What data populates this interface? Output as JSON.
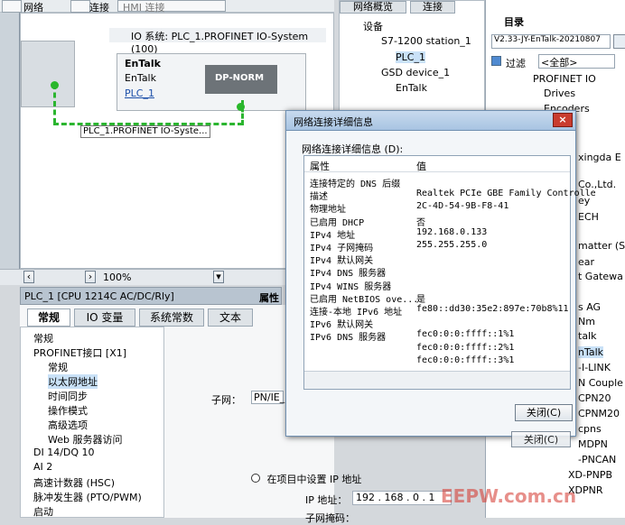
{
  "toolbar": {
    "network": "网络",
    "connection": "连接",
    "hmi_connection": "HMI 连接"
  },
  "canvas": {
    "title": "IO 系统: PLC_1.PROFINET IO-System (100)",
    "device_name": "EnTalk",
    "device_type": "EnTalk",
    "device_link": "PLC_1",
    "device_card": "DP-NORM",
    "network_label": "PLC_1.PROFINET IO-Syste...",
    "zoom": "100%"
  },
  "properties": {
    "header": "PLC_1 [CPU 1214C AC/DC/Rly]",
    "header_right": "属性",
    "tabs": [
      "常规",
      "IO 变量",
      "系统常数",
      "文本"
    ],
    "tree": [
      "常规",
      "PROFINET接口 [X1]",
      "常规",
      "以太网地址",
      "时间同步",
      "操作模式",
      "高级选项",
      "Web 服务器访问",
      "DI 14/DQ 10",
      "AI 2",
      "高速计数器 (HSC)",
      "脉冲发生器 (PTO/PWM)",
      "启动"
    ],
    "subnet_label": "子网：",
    "subnet_value": "PN/IE_",
    "ip_option": "在项目中设置 IP 地址",
    "ip_label": "IP 地址：",
    "ip_value": "192 . 168 . 0 . 1",
    "mask_label": "子网掩码："
  },
  "network_overview": {
    "tabs": [
      "网络概览",
      "连接"
    ],
    "header": "设备",
    "items": [
      "S7-1200 station_1",
      "PLC_1",
      "GSD device_1",
      "EnTalk"
    ]
  },
  "catalog": {
    "title": "目录",
    "search": "V2.33-JY-EnTalk-20210807",
    "filter_label": "过滤",
    "filter_value": "<全部>",
    "items": [
      "PROFINET IO",
      "Drives",
      "Encoders",
      "xingda E",
      "Co.,Ltd.",
      "ey",
      "ECH",
      "matter (S",
      "ear",
      "t Gatewa",
      "s AG",
      "Nm",
      "talk",
      "nTalk",
      "-I-LINK",
      "N Couple",
      "CPN20",
      "CPNM20",
      "cpns",
      "MDPN",
      "-PNCAN",
      "XD-PNPB",
      "XDPNR"
    ]
  },
  "dialog": {
    "title": "网络连接详细信息",
    "subtitle": "网络连接详细信息 (D):",
    "col_property": "属性",
    "col_value": "值",
    "rows": [
      {
        "k": "连接特定的 DNS 后缀",
        "v": ""
      },
      {
        "k": "描述",
        "v": "Realtek PCIe GBE Family Controlle"
      },
      {
        "k": "物理地址",
        "v": "2C-4D-54-9B-F8-41"
      },
      {
        "k": "已启用 DHCP",
        "v": "否"
      },
      {
        "k": "IPv4 地址",
        "v": "192.168.0.133"
      },
      {
        "k": "IPv4 子网掩码",
        "v": "255.255.255.0"
      },
      {
        "k": "IPv4 默认网关",
        "v": ""
      },
      {
        "k": "IPv4 DNS 服务器",
        "v": ""
      },
      {
        "k": "IPv4 WINS 服务器",
        "v": ""
      },
      {
        "k": "已启用 NetBIOS ove...",
        "v": "是"
      },
      {
        "k": "连接-本地 IPv6 地址",
        "v": "fe80::dd30:35e2:897e:70b8%11"
      },
      {
        "k": "IPv6 默认网关",
        "v": ""
      },
      {
        "k": "IPv6 DNS 服务器",
        "v": "fec0:0:0:ffff::1%1"
      },
      {
        "k": "",
        "v": "fec0:0:0:ffff::2%1"
      },
      {
        "k": "",
        "v": "fec0:0:0:ffff::3%1"
      }
    ],
    "close_button": "关闭(C)",
    "back_button": "关闭(C)"
  },
  "watermark": "EEPW.com.cn"
}
